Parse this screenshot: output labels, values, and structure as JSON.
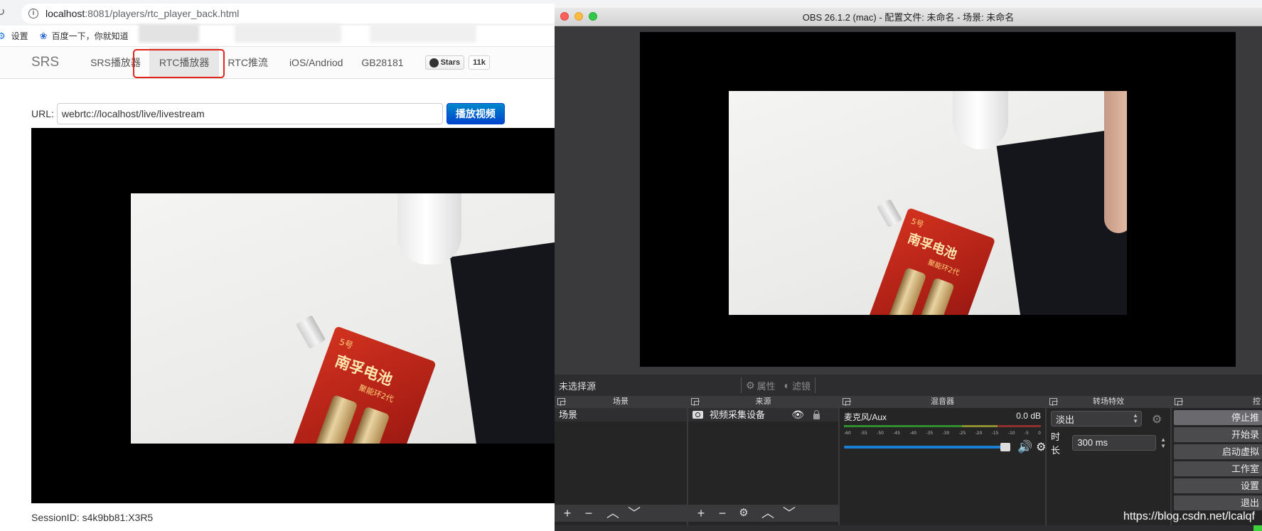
{
  "browser": {
    "url_host": "localhost",
    "url_path": ":8081/players/rtc_player_back.html",
    "bookmarks": [
      {
        "label": "设置",
        "icon": "gear-icon"
      },
      {
        "label": "百度一下，你就知道",
        "icon": "baidu-paw-icon"
      }
    ]
  },
  "nav": {
    "brand": "SRS",
    "links": [
      "SRS播放器",
      "RTC播放器",
      "RTC推流",
      "iOS/Andriod",
      "GB28181"
    ],
    "active_index": 1,
    "github_label": "Stars",
    "github_count": "11k"
  },
  "player": {
    "url_label": "URL:",
    "url_value": "webrtc://localhost/live/livestream",
    "play_button": "播放视频",
    "session": "SessionID: s4k9bb81:X3R5"
  },
  "scene": {
    "pack_title": "南孚电池",
    "pack_sub": "聚能环2代",
    "pack_badge": "5号"
  },
  "obs": {
    "title": "OBS 26.1.2 (mac) - 配置文件: 未命名 - 场景: 未命名",
    "no_source_selected": "未选择源",
    "properties_label": "属性",
    "filters_label": "滤镜",
    "docks": {
      "scenes": {
        "title": "场景",
        "items": [
          "场景"
        ]
      },
      "sources": {
        "title": "来源",
        "items": [
          "视频采集设备"
        ]
      },
      "mixer": {
        "title": "混音器",
        "channel": "麦克风/Aux",
        "level": "0.0 dB",
        "ticks": [
          "-60",
          "-55",
          "-50",
          "-45",
          "-40",
          "-35",
          "-30",
          "-25",
          "-20",
          "-15",
          "-10",
          "-5",
          "0"
        ],
        "volume": 1.0
      },
      "transitions": {
        "title": "转场特效",
        "selected": "淡出",
        "duration_label": "时长",
        "duration_value": "300 ms"
      },
      "controls": {
        "title": "控",
        "buttons": [
          "停止推",
          "开始录",
          "启动虚拟",
          "工作室",
          "设置",
          "退出"
        ]
      }
    }
  },
  "watermark": "https://blog.csdn.net/lcalqf",
  "colors": {
    "highlight_red": "#e0251b",
    "play_blue": "#0055cc",
    "obs_dark": "#252526",
    "meter_green": "#3cd33c",
    "volume_blue": "#1a7ed4"
  }
}
